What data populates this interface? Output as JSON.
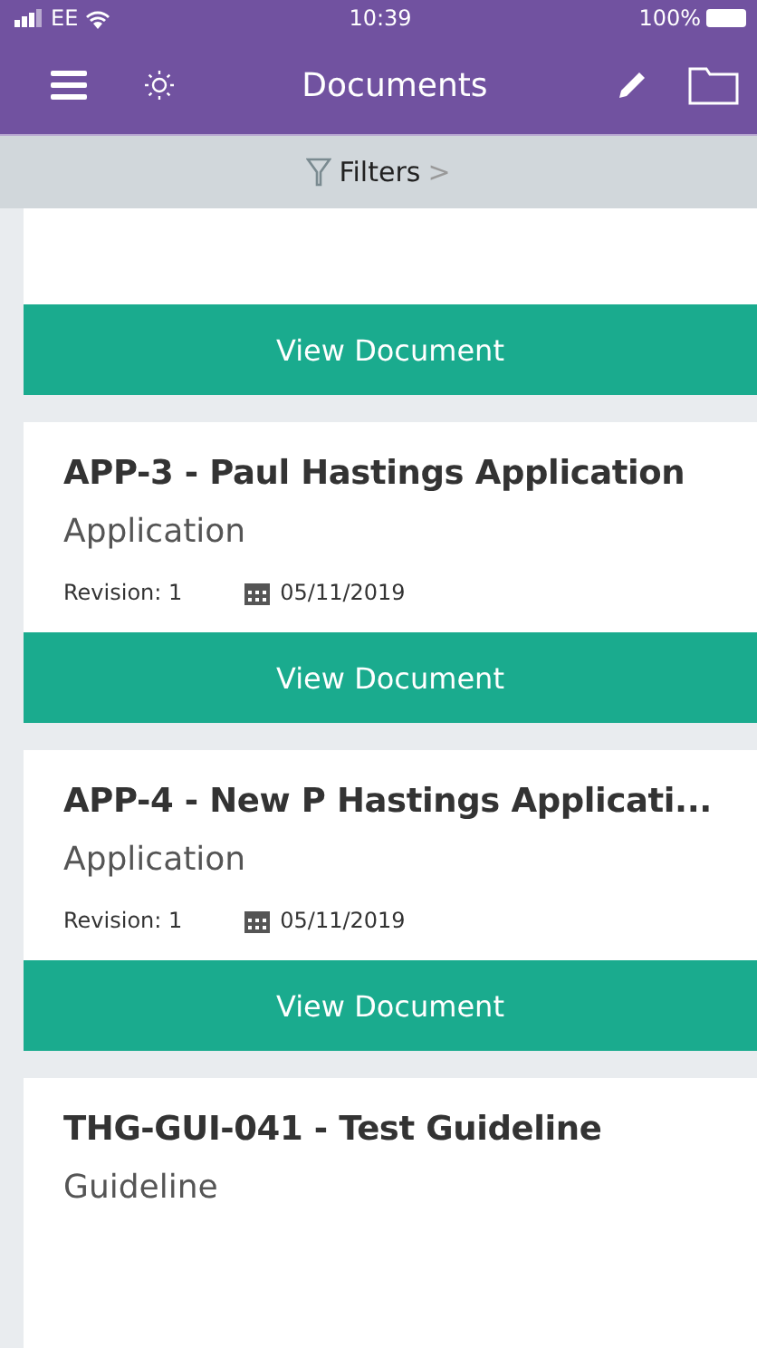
{
  "status_bar": {
    "carrier": "EE",
    "time": "10:39",
    "battery": "100%"
  },
  "nav_bar": {
    "title": "Documents"
  },
  "filter_bar": {
    "label": "Filters",
    "chevron": ">"
  },
  "documents": [
    {
      "button": "View Document"
    },
    {
      "title": "APP-3 - Paul Hastings Application",
      "type": "Application",
      "revision": "Revision: 1",
      "date": "05/11/2019",
      "button": "View Document"
    },
    {
      "title": "APP-4 - New P Hastings Applicati...",
      "type": "Application",
      "revision": "Revision: 1",
      "date": "05/11/2019",
      "button": "View Document"
    },
    {
      "title": "THG-GUI-041 - Test Guideline",
      "type": "Guideline"
    }
  ]
}
